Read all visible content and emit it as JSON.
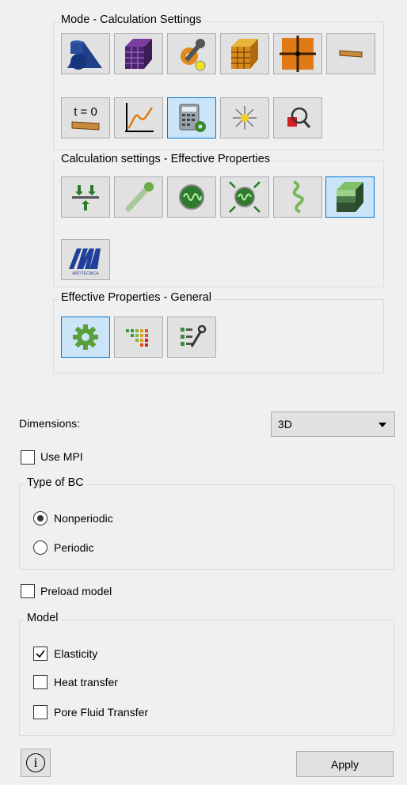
{
  "mode_group": {
    "title": "Mode - Calculation Settings",
    "buttons": [
      {
        "icon": "shapes-icon"
      },
      {
        "icon": "purple-cube-icon"
      },
      {
        "icon": "wrench-gear-icon"
      },
      {
        "icon": "orange-cube-icon"
      },
      {
        "icon": "grid-icon"
      },
      {
        "icon": "beam-icon"
      },
      {
        "icon": "time-zero-icon",
        "text": "t = 0"
      },
      {
        "icon": "curve-graph-icon"
      },
      {
        "icon": "calculator-gear-icon"
      },
      {
        "icon": "sparkle-icon"
      },
      {
        "icon": "magnifier-icon"
      }
    ]
  },
  "calc_group": {
    "title": "Calculation settings - Effective Properties",
    "buttons": [
      {
        "icon": "load-arrows-icon"
      },
      {
        "icon": "fiber-icon"
      },
      {
        "icon": "wave-circle-icon"
      },
      {
        "icon": "wave-arrows-icon"
      },
      {
        "icon": "helix-icon"
      },
      {
        "icon": "green-cube-icon"
      },
      {
        "icon": "logo-icon",
        "logo_text": "ARTITECNICA"
      }
    ]
  },
  "general_group": {
    "title": "Effective Properties - General",
    "buttons": [
      {
        "icon": "gear-icon"
      },
      {
        "icon": "bars-icon"
      },
      {
        "icon": "list-wrench-icon"
      }
    ]
  },
  "dimensions": {
    "label": "Dimensions:",
    "value": "3D"
  },
  "use_mpi": {
    "label": "Use MPI",
    "checked": false
  },
  "bc_group": {
    "title": "Type of BC",
    "options": [
      {
        "label": "Nonperiodic",
        "selected": true
      },
      {
        "label": "Periodic",
        "selected": false
      }
    ]
  },
  "preload": {
    "label": "Preload model",
    "checked": false
  },
  "model_group": {
    "title": "Model",
    "options": [
      {
        "label": "Elasticity",
        "checked": true
      },
      {
        "label": "Heat transfer",
        "checked": false
      },
      {
        "label": "Pore Fluid Transfer",
        "checked": false
      }
    ]
  },
  "footer": {
    "info_glyph": "i",
    "apply_label": "Apply"
  },
  "colors": {
    "accent": "#0078d7",
    "active_bg": "#cce4f7"
  }
}
